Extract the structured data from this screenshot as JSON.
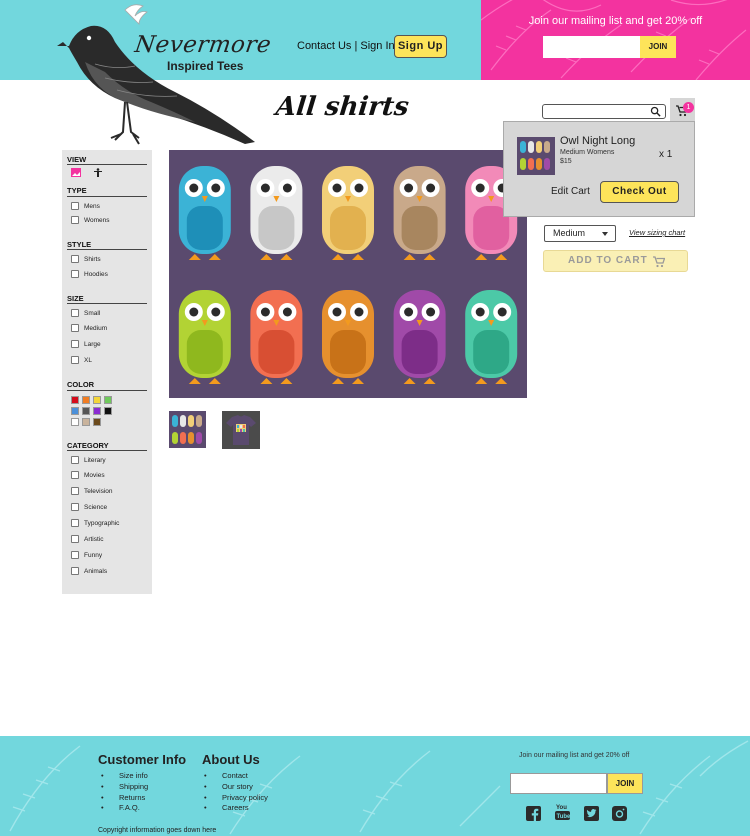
{
  "header": {
    "logo_title": "Nevermore",
    "logo_subtitle": "Inspired Tees",
    "contact_link": "Contact Us",
    "separator": "|",
    "signin_link": "Sign In",
    "signup_button": "Sign Up",
    "mailing_text": "Join our mailing list and get 20% off",
    "join_button": "JOIN"
  },
  "main": {
    "title": "All shirts"
  },
  "cart": {
    "badge_count": "1",
    "item_name": "Owl Night Long",
    "item_variant": "Medium Womens",
    "item_price": "$15",
    "item_qty": "x 1",
    "edit_cart": "Edit Cart",
    "checkout": "Check Out"
  },
  "product": {
    "size_selected": "Medium",
    "sizing_link": "View sizing chart",
    "add_to_cart": "ADD TO CART"
  },
  "sidebar": {
    "view_heading": "VIEW",
    "type_heading": "TYPE",
    "type_options": [
      "Mens",
      "Womens"
    ],
    "style_heading": "STYLE",
    "style_options": [
      "Shirts",
      "Hoodies"
    ],
    "size_heading": "SIZE",
    "size_options": [
      "Small",
      "Medium",
      "Large",
      "XL"
    ],
    "color_heading": "COLOR",
    "colors": [
      "#d40b1b",
      "#f07c22",
      "#f4d63a",
      "#6fc95b",
      "#4a8fd9",
      "#555555",
      "#8b2bd1",
      "#111111",
      "#ffffff",
      "#c9b39c",
      "#6b4a1c"
    ],
    "category_heading": "CATEGORY",
    "category_options": [
      "Literary",
      "Movies",
      "Television",
      "Science",
      "Typographic",
      "Artistic",
      "Funny",
      "Animals"
    ]
  },
  "footer": {
    "customer_info_heading": "Customer Info",
    "customer_links": [
      "Size info",
      "Shipping",
      "Returns",
      "F.A.Q."
    ],
    "about_heading": "About Us",
    "about_links": [
      "Contact",
      "Our story",
      "Privacy policy",
      "Careers"
    ],
    "mailing_text": "Join our mailing list and get 20% off",
    "join_button": "JOIN",
    "copyright": "Copyright information goes down here"
  },
  "icons": [
    "raven-logo",
    "search-icon",
    "cart-icon",
    "image-view-icon",
    "model-view-icon",
    "chevron-down-icon",
    "facebook-icon",
    "youtube-icon",
    "twitter-icon",
    "instagram-icon"
  ],
  "colors": {
    "teal": "#72d7dd",
    "pink": "#f3339f",
    "yellow": "#fde45a",
    "sidebar_bg": "#e5e5e5",
    "product_bg": "#5a4a6e"
  }
}
